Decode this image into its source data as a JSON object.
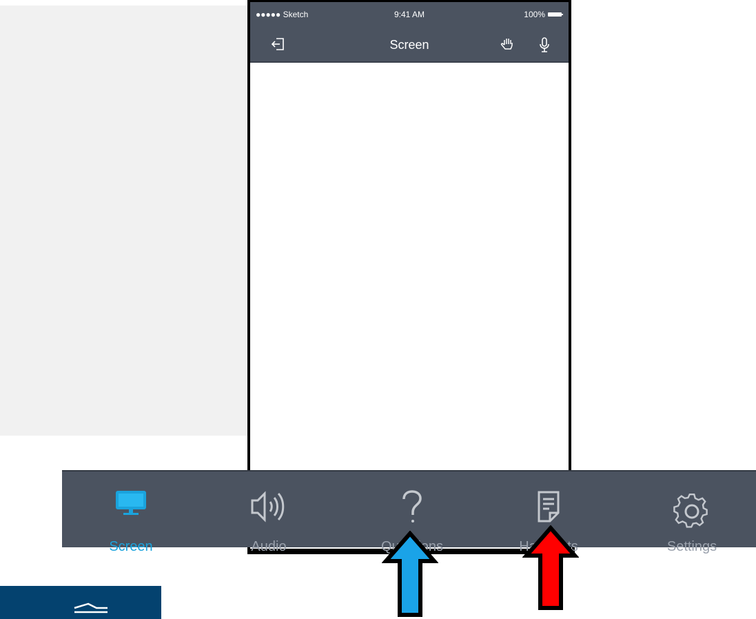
{
  "status_bar": {
    "carrier": "●●●●● Sketch",
    "time": "9:41 AM",
    "battery": "100%"
  },
  "nav_bar": {
    "title": "Screen"
  },
  "tabs": [
    {
      "label": "Screen",
      "icon": "monitor-icon",
      "active": true
    },
    {
      "label": "Audio",
      "icon": "speaker-icon",
      "active": false
    },
    {
      "label": "Questions",
      "icon": "question-icon",
      "active": false
    },
    {
      "label": "Handouts",
      "icon": "handout-icon",
      "active": false
    },
    {
      "label": "Settings",
      "icon": "gear-icon",
      "active": false
    }
  ],
  "annotations": {
    "arrow_colors": {
      "questions": "#1aa3e8",
      "handouts": "#ff0000"
    }
  }
}
